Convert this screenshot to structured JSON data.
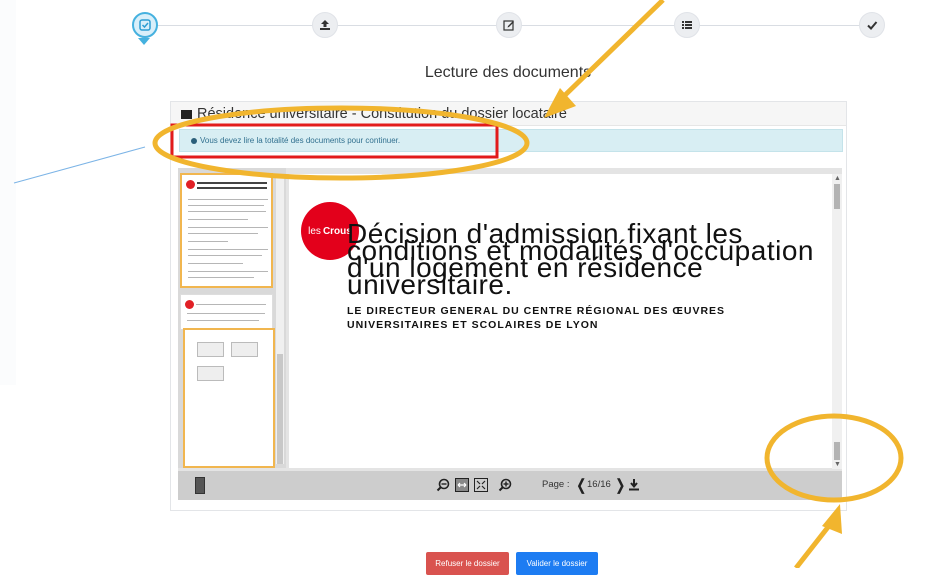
{
  "stepper": {
    "steps": [
      {
        "icon": "checklist-icon",
        "active": true
      },
      {
        "icon": "upload-icon",
        "active": false
      },
      {
        "icon": "edit-icon",
        "active": false
      },
      {
        "icon": "list-icon",
        "active": false
      },
      {
        "icon": "check-icon",
        "active": false
      }
    ],
    "active_color": "#45b1df"
  },
  "section": {
    "title": "Lecture des documents"
  },
  "panel": {
    "title": "Résidence universitaire - Constitution du dossier locataire",
    "info": "Vous devez lire la totalité des documents pour continuer."
  },
  "document": {
    "logo_prefix": "les",
    "logo_brand": "Crous",
    "title_line1": "Décision d'admission fixant les",
    "title_line2": "conditions et modalités d'occupation",
    "title_line3": "d'un logement en résidence",
    "title_line4": "universitaire.",
    "director_line1": "LE DIRECTEUR GENERAL DU CENTRE RÉGIONAL DES ŒUVRES",
    "director_line2": "UNIVERSITAIRES ET SCOLAIRES DE LYON"
  },
  "toolbar": {
    "page_label": "Page :",
    "page_value": "16/16",
    "icons": [
      "zoom-out-icon",
      "fit-width-icon",
      "fit-page-icon",
      "zoom-in-icon",
      "download-icon"
    ]
  },
  "actions": {
    "refuse_label": "Refuser le dossier",
    "validate_label": "Valider le dossier",
    "refuse_color": "#d9534f",
    "validate_color": "#1d7cf2"
  },
  "annotations": {
    "highlight_color": "#f1b52e",
    "box_color": "#e21b1b"
  }
}
